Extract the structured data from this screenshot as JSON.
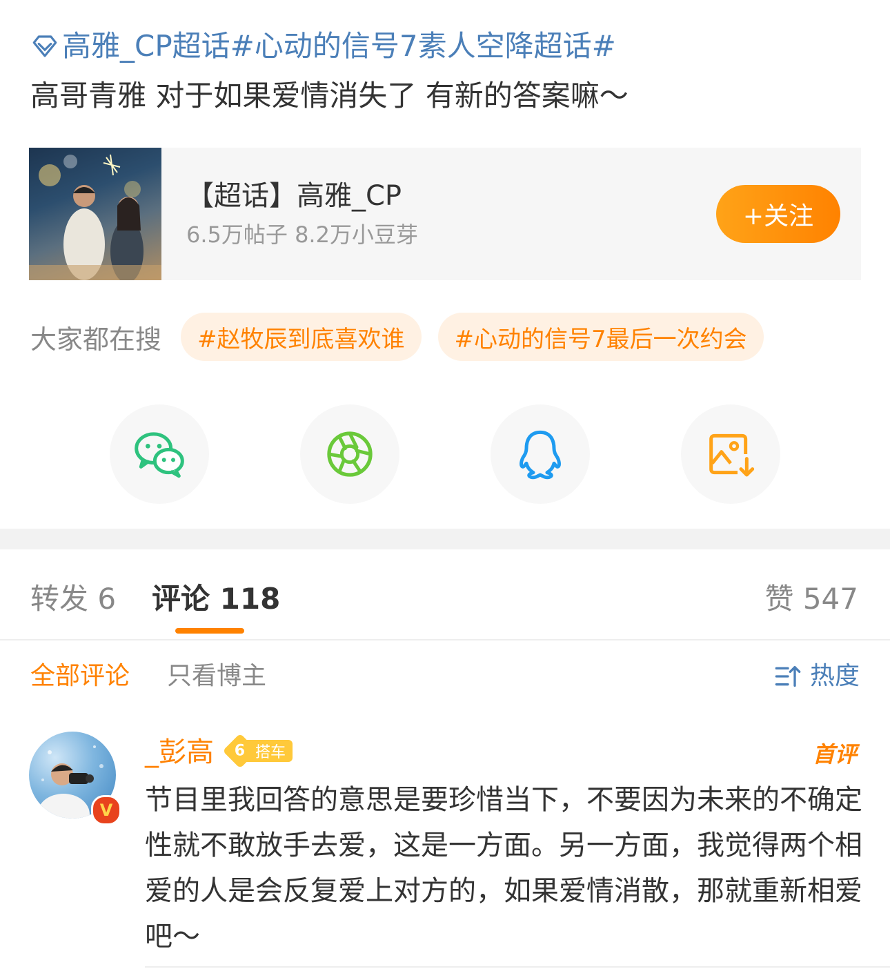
{
  "post": {
    "topic_line": "高雅_CP超话#心动的信号7素人空降超话#",
    "text": "高哥青雅 对于如果爱情消失了 有新的答案嘛～"
  },
  "card": {
    "title": "【超话】高雅_CP",
    "stats": "6.5万帖子 8.2万小豆芽",
    "follow_label": "+关注"
  },
  "search": {
    "label": "大家都在搜",
    "chips": [
      "#赵牧辰到底喜欢谁",
      "#心动的信号7最后一次约会"
    ]
  },
  "share": {
    "icons": [
      "wechat-icon",
      "moments-icon",
      "qq-icon",
      "save-image-icon"
    ]
  },
  "tabs": {
    "repost": "转发 6",
    "comments": "评论 118",
    "likes": "赞 547"
  },
  "filters": {
    "all": "全部评论",
    "author_only": "只看博主",
    "sort": "热度"
  },
  "comment": {
    "username": "_彭高",
    "level": "6",
    "level_text": "搭车",
    "first_badge": "首评",
    "text": "节目里我回答的意思是要珍惜当下，不要因为未来的不确定性就不敢放手去爱，这是一方面。另一方面，我觉得两个相爱的人是会反复爱上对方的，如果爱情消散，那就重新相爱吧～"
  },
  "colors": {
    "accent": "#ff8200",
    "link": "#4b7fb8",
    "chip_bg": "#fff1e3"
  }
}
